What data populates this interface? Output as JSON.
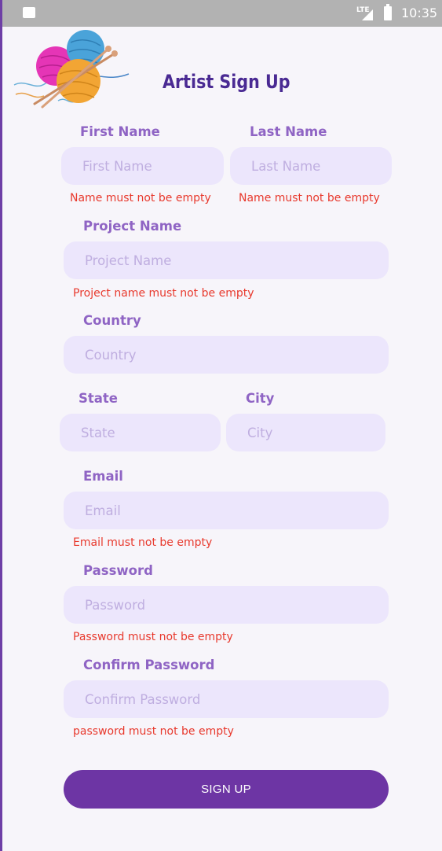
{
  "status_bar": {
    "network": "LTE",
    "time": "10:35"
  },
  "header": {
    "title": "Artist Sign Up",
    "logo_icon": "yarn-balls-icon"
  },
  "form": {
    "first_name": {
      "label": "First Name",
      "placeholder": "First Name",
      "error": "Name must not be empty"
    },
    "last_name": {
      "label": "Last Name",
      "placeholder": "Last Name",
      "error": "Name must not be empty"
    },
    "project_name": {
      "label": "Project Name",
      "placeholder": "Project Name",
      "error": "Project name must not be empty"
    },
    "country": {
      "label": "Country",
      "placeholder": "Country"
    },
    "state": {
      "label": "State",
      "placeholder": "State"
    },
    "city": {
      "label": "City",
      "placeholder": "City"
    },
    "email": {
      "label": "Email",
      "placeholder": "Email",
      "error": "Email must not be empty"
    },
    "password": {
      "label": "Password",
      "placeholder": "Password",
      "error": "Password must not be empty"
    },
    "confirm_password": {
      "label": "Confirm Password",
      "placeholder": "Confirm Password",
      "error": "password must not be empty"
    },
    "submit_label": "SIGN UP"
  },
  "colors": {
    "primary": "#6d35a4",
    "label": "#8f64c4",
    "field_bg": "#ece6fc",
    "placeholder": "#bfaee0",
    "error": "#e8392d",
    "title": "#4a2a93"
  }
}
